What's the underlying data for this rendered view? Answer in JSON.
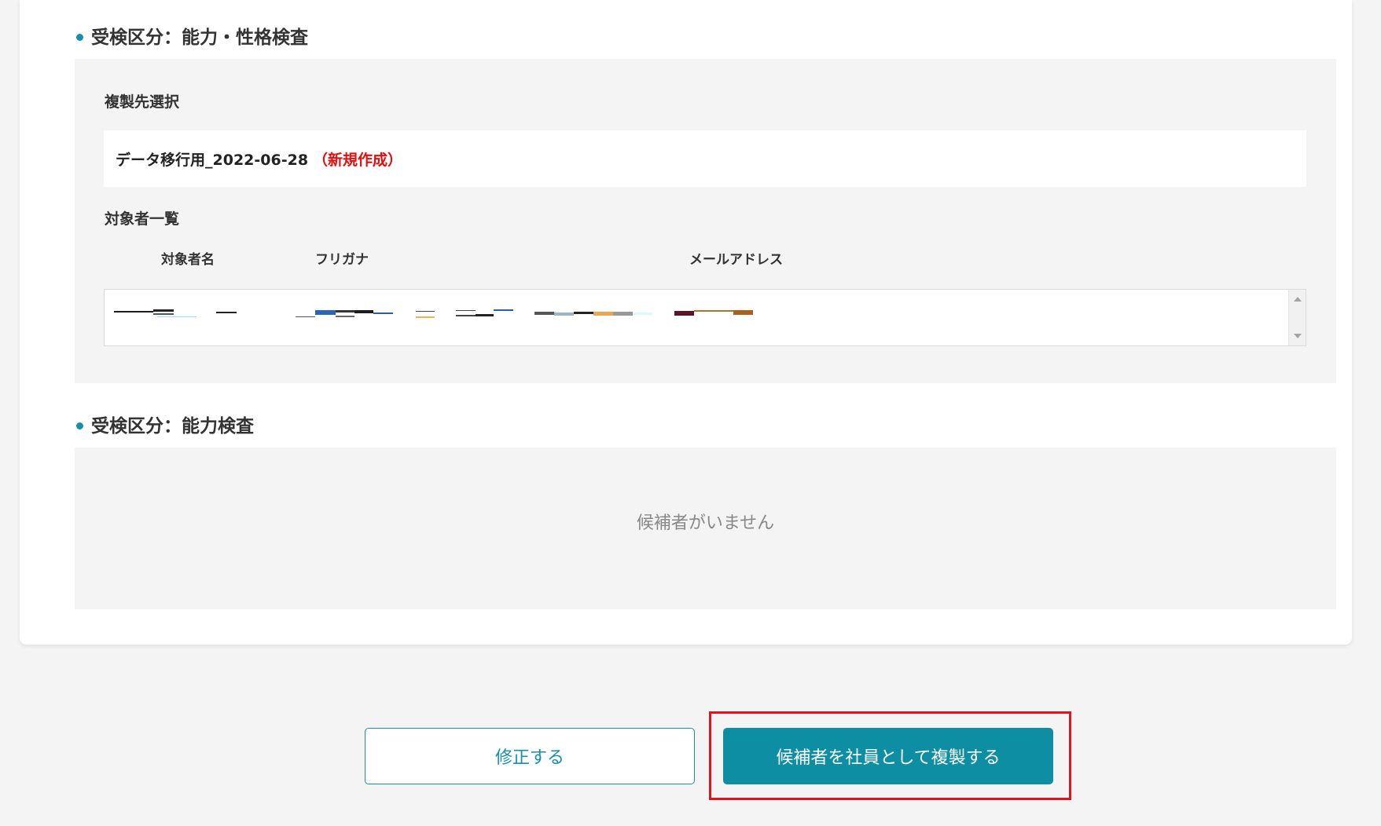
{
  "section1": {
    "title": "受検区分：能力・性格検査",
    "destination_label": "複製先選択",
    "destination_name": "データ移行用_2022-06-28",
    "destination_tag": "（新規作成）",
    "list_label": "対象者一覧",
    "columns": [
      "対象者名",
      "フリガナ",
      "メールアドレス"
    ]
  },
  "section2": {
    "title": "受検区分：能力検査",
    "empty_message": "候補者がいません"
  },
  "buttons": {
    "edit": "修正する",
    "copy": "候補者を社員として複製する"
  },
  "colors": {
    "accent": "#178fa6",
    "primary_button": "#0e8ea3",
    "new_tag": "#e01010",
    "highlight": "#e0141e"
  },
  "icons": {
    "bullet": "dot-icon",
    "scroll_up": "scroll-up-arrow-icon",
    "scroll_down": "scroll-down-arrow-icon"
  }
}
